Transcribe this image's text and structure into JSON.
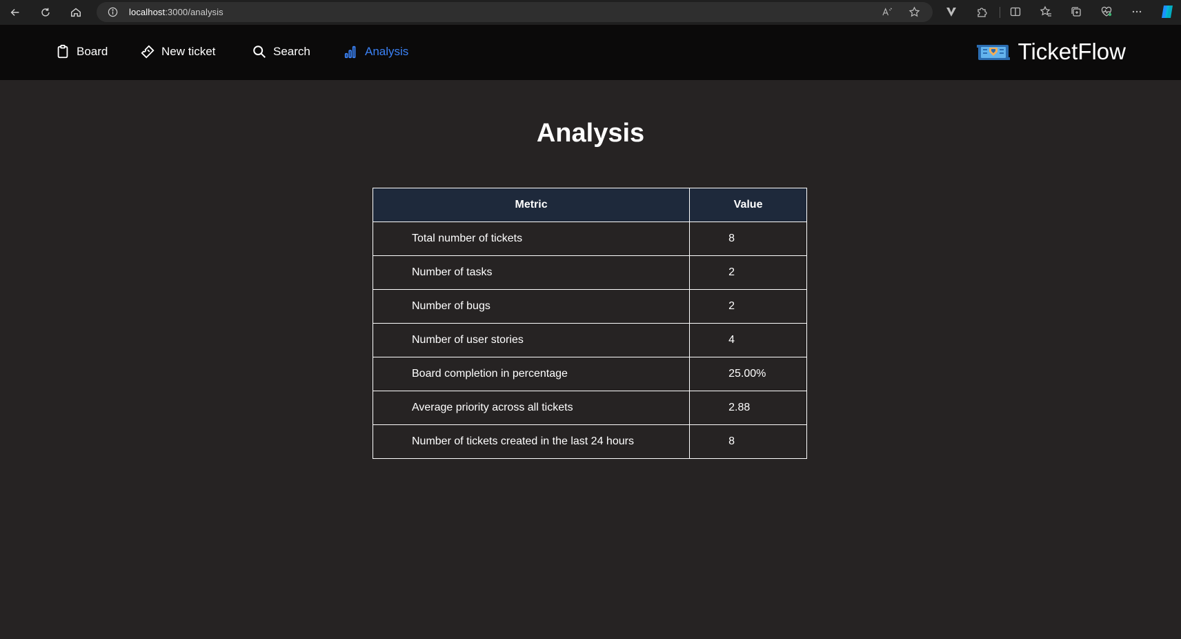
{
  "browser": {
    "url_host": "localhost",
    "url_path": ":3000/analysis"
  },
  "nav": {
    "items": [
      {
        "label": "Board",
        "icon": "clipboard-icon"
      },
      {
        "label": "New ticket",
        "icon": "ticket-icon"
      },
      {
        "label": "Search",
        "icon": "search-icon"
      },
      {
        "label": "Analysis",
        "icon": "bar-chart-icon",
        "active": true
      }
    ],
    "active_color": "#3b82f6"
  },
  "brand": {
    "name": "TicketFlow",
    "logo": "ticket-logo-icon"
  },
  "page": {
    "title": "Analysis"
  },
  "table": {
    "headers": {
      "metric": "Metric",
      "value": "Value"
    },
    "header_bg": "#1e293b",
    "rows": [
      {
        "metric": "Total number of tickets",
        "value": "8"
      },
      {
        "metric": "Number of tasks",
        "value": "2"
      },
      {
        "metric": "Number of bugs",
        "value": "2"
      },
      {
        "metric": "Number of user stories",
        "value": "4"
      },
      {
        "metric": "Board completion in percentage",
        "value": "25.00%"
      },
      {
        "metric": "Average priority across all tickets",
        "value": "2.88"
      },
      {
        "metric": "Number of tickets created in the last 24 hours",
        "value": "8"
      }
    ]
  }
}
